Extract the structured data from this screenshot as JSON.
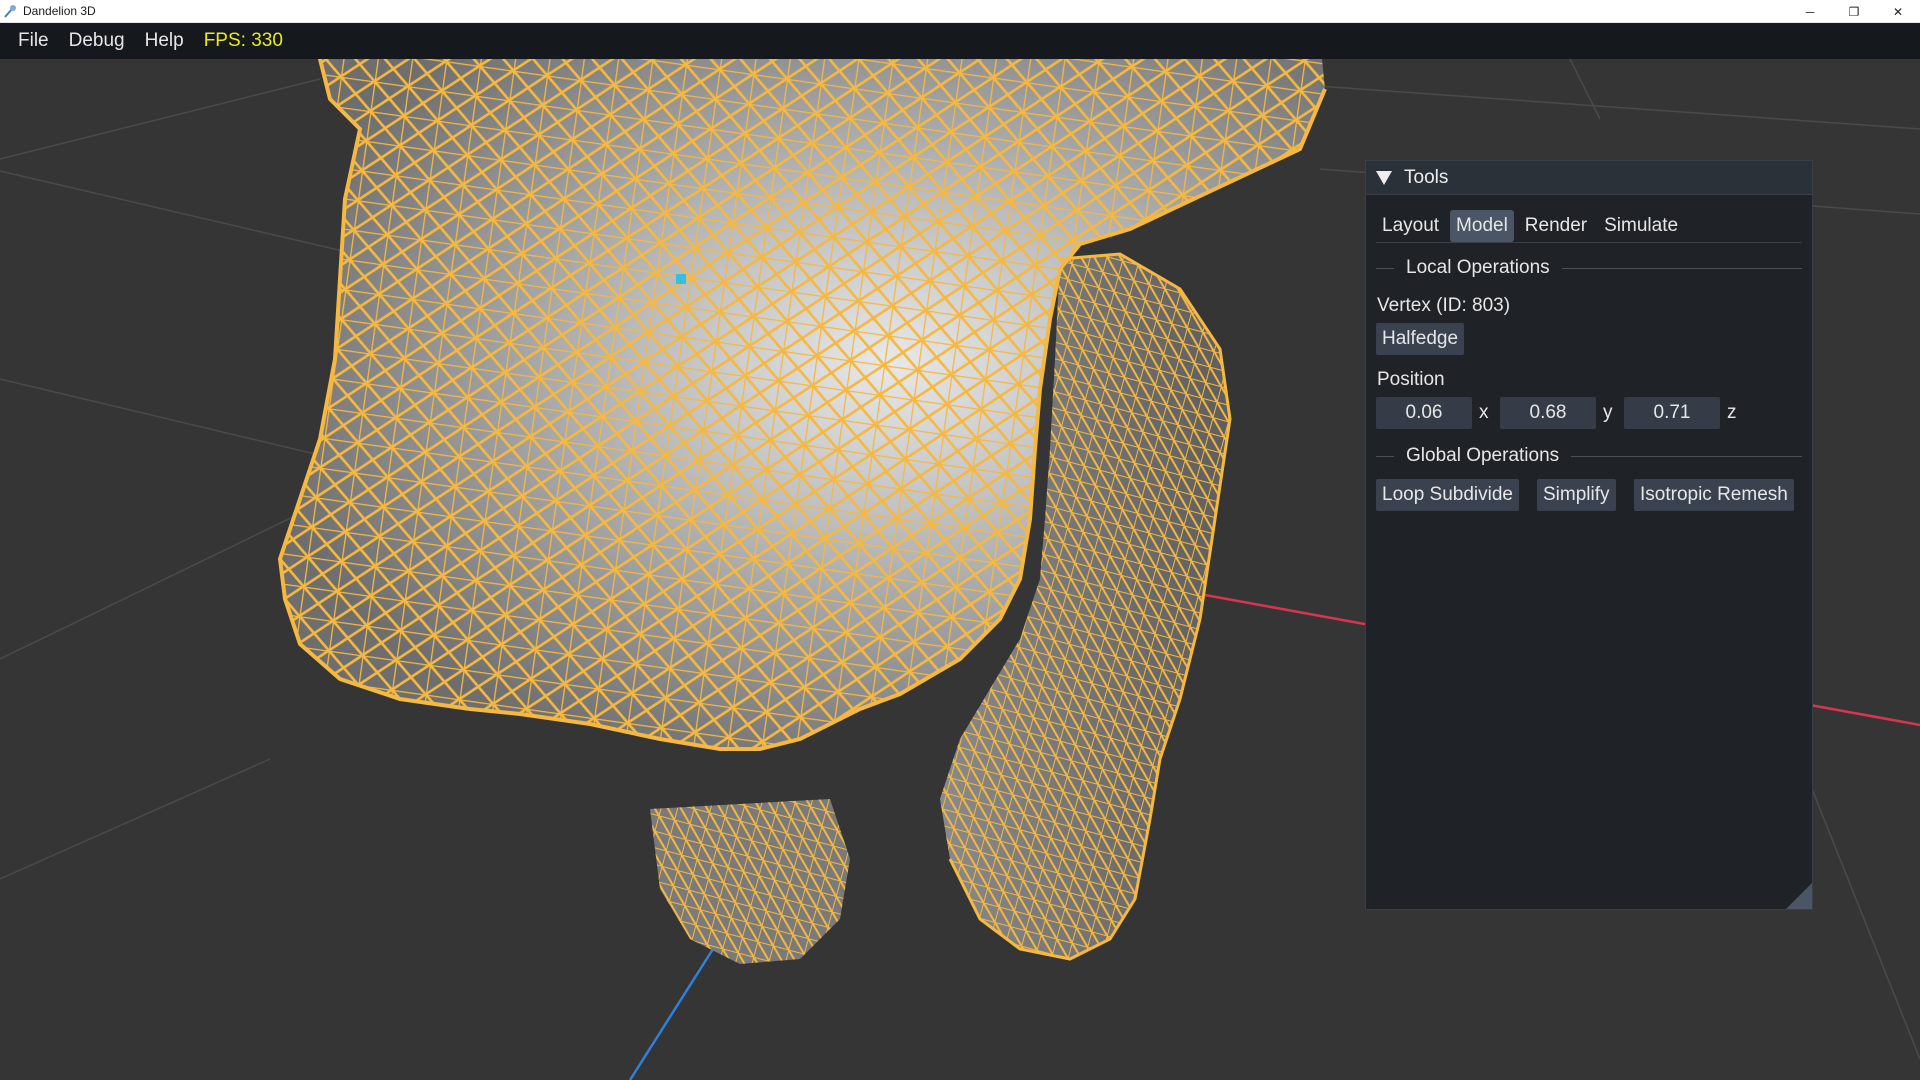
{
  "window": {
    "title": "Dandelion 3D",
    "icon": "dandelion-app-icon",
    "controls": {
      "minimize": "─",
      "maximize": "❐",
      "close": "✕"
    }
  },
  "menubar": {
    "items": [
      "File",
      "Debug",
      "Help"
    ],
    "fps": "FPS: 330"
  },
  "colors": {
    "wireframe": "#f5b841",
    "mesh_light": "#e6e6e6",
    "mesh_dark": "#6e6e6e",
    "x_axis": "#d8354e",
    "z_axis": "#2f7fdc",
    "selected_vertex": "#36c0e0",
    "fps_text": "#eaea1a"
  },
  "tools": {
    "title": "Tools",
    "tabs": [
      "Layout",
      "Model",
      "Render",
      "Simulate"
    ],
    "active_tab": "Model",
    "local_ops": {
      "section": "Local Operations",
      "vertex_label": "Vertex (ID: 803)",
      "halfedge_button": "Halfedge",
      "position_label": "Position",
      "position": {
        "x": "0.06",
        "y": "0.68",
        "z": "0.71"
      },
      "axis_labels": {
        "x": "x",
        "y": "y",
        "z": "z"
      }
    },
    "global_ops": {
      "section": "Global Operations",
      "buttons": [
        "Loop Subdivide",
        "Simplify",
        "Isotropic Remesh"
      ]
    }
  }
}
